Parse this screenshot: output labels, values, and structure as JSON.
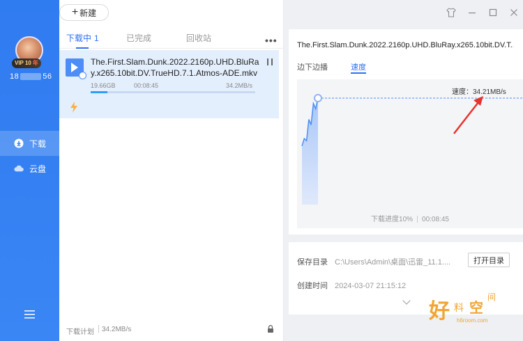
{
  "sidebar": {
    "vip_badge": "VIP 10",
    "vip_year": "年",
    "user_id_prefix": "18",
    "user_id_suffix": "56",
    "nav": [
      {
        "label": "下载",
        "icon": "download-icon",
        "active": true
      },
      {
        "label": "云盘",
        "icon": "cloud-icon",
        "active": false
      }
    ],
    "menu_icon": "hamburger-menu-icon"
  },
  "toolbar": {
    "new_label": "新建"
  },
  "tabs": {
    "downloading": "下载中",
    "downloading_count": "1",
    "completed": "已完成",
    "trash": "回收站",
    "more": "•••"
  },
  "task": {
    "name": "The.First.Slam.Dunk.2022.2160p.UHD.BluRay.x265.10bit.DV.TrueHD.7.1.Atmos-ADE.mkv",
    "size": "19.66GB",
    "time": "00:08:45",
    "speed": "34.2MB/s",
    "progress": 0.1
  },
  "bottom_bar": {
    "plan_label": "下载计划",
    "speed": "34.2MB/s"
  },
  "detail": {
    "title": "The.First.Slam.Dunk.2022.2160p.UHD.BluRay.x265.10bit.DV.T...",
    "tabs": [
      "边下边播",
      "速度"
    ],
    "active_tab": 1,
    "speed_label": "速度：34.21MB/s",
    "footer_progress": "下载进度10%",
    "footer_time": "00:08:45"
  },
  "chart_data": {
    "type": "area",
    "series": [
      {
        "values": [
          0.55,
          0.62,
          0.6,
          0.8,
          0.75,
          0.95,
          0.9,
          1.0
        ]
      }
    ],
    "xlim": [
      0,
      7
    ],
    "ylim": [
      0,
      1
    ],
    "grid": false
  },
  "info": {
    "save_dir_label": "保存目录",
    "save_dir_value": "C:\\Users\\Admin\\桌面\\迅雷_11.1....",
    "open_dir_label": "打开目录",
    "created_label": "创建时间",
    "created_value": "2024-03-07 21:15:12"
  },
  "watermark": {
    "hao": "好",
    "liao": "料",
    "kong": "空",
    "jian": "间",
    "url": "h6room.com"
  },
  "colors": {
    "accent": "#2e6ff2",
    "sidebar": "#3a86f5",
    "arrow": "#e8322c",
    "watermark": "#f0a533"
  }
}
